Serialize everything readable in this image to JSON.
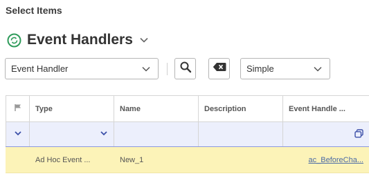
{
  "page": {
    "section_title": "Select Items"
  },
  "object": {
    "title": "Event Handlers",
    "icon": "event-handler-icon"
  },
  "toolbar": {
    "type_select_value": "Event Handler",
    "mode_select_value": "Simple"
  },
  "grid": {
    "columns": [
      "Type",
      "Name",
      "Description",
      "Event Handle ..."
    ],
    "rows": [
      {
        "type": "Ad Hoc Event ...",
        "name": "New_1",
        "description": "",
        "event_handler": "ac_BeforeCha..."
      }
    ]
  },
  "colors": {
    "accent_green": "#2e9b5a",
    "filter_row_bg": "#eceffc",
    "filter_row_border": "#8b98e0",
    "selected_row_bg": "#fcf3b8",
    "link": "#4a6aa5"
  }
}
